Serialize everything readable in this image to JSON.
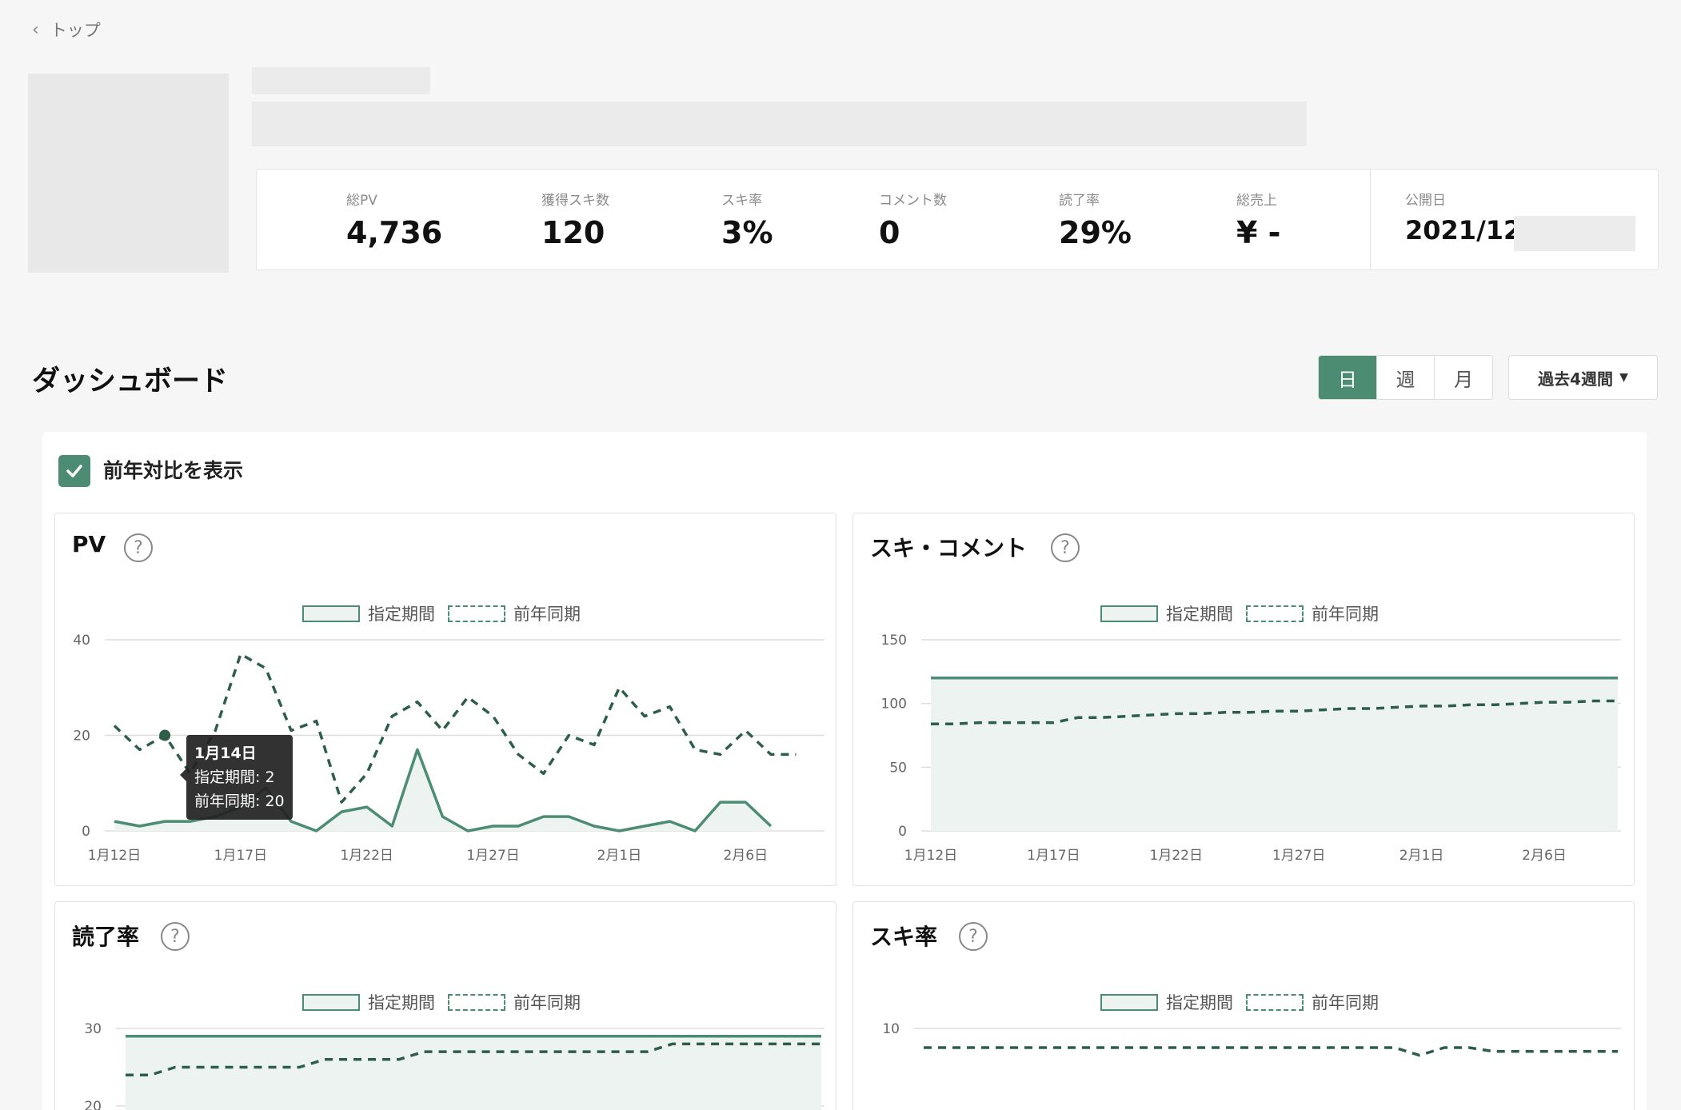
{
  "nav": {
    "back_label": "トップ"
  },
  "stats": [
    {
      "label": "総PV",
      "value": "4,736"
    },
    {
      "label": "獲得スキ数",
      "value": "120"
    },
    {
      "label": "スキ率",
      "value": "3%"
    },
    {
      "label": "コメント数",
      "value": "0"
    },
    {
      "label": "読了率",
      "value": "29%"
    },
    {
      "label": "総売上",
      "value": "¥ -"
    }
  ],
  "published": {
    "label": "公開日",
    "value": "2021/12/"
  },
  "dashboard": {
    "title": "ダッシュボード",
    "period_tabs": [
      "日",
      "週",
      "月"
    ],
    "selected_tab": "日",
    "range_label": "過去4週間",
    "compare_label": "前年対比を表示",
    "compare_checked": true,
    "legend": {
      "current": "指定期間",
      "previous": "前年同期"
    }
  },
  "colors": {
    "accent": "#4b8c72",
    "fill": "#edf3f0",
    "dark_series": "#2e5e4a"
  },
  "tooltip": {
    "title": "1月14日",
    "current_line": "指定期間: 2",
    "previous_line": "前年同期: 20"
  },
  "chart_data": [
    {
      "type": "line",
      "title": "PV",
      "x": [
        "1月12日",
        "1月13日",
        "1月14日",
        "1月15日",
        "1月16日",
        "1月17日",
        "1月18日",
        "1月19日",
        "1月20日",
        "1月21日",
        "1月22日",
        "1月23日",
        "1月24日",
        "1月25日",
        "1月26日",
        "1月27日",
        "1月28日",
        "1月29日",
        "1月30日",
        "1月31日",
        "2月1日",
        "2月2日",
        "2月3日",
        "2月4日",
        "2月5日",
        "2月6日",
        "2月7日",
        "2月8日",
        "2月9日"
      ],
      "x_ticks": [
        "1月12日",
        "1月17日",
        "1月22日",
        "1月27日",
        "2月1日",
        "2月6日"
      ],
      "ylim": [
        0,
        40
      ],
      "y_ticks": [
        0,
        20,
        40
      ],
      "series": [
        {
          "name": "指定期間",
          "style": "solid-area",
          "values": [
            2,
            1,
            2,
            2,
            3,
            5,
            9,
            2,
            0,
            4,
            5,
            1,
            17,
            3,
            0,
            1,
            1,
            3,
            3,
            1,
            0,
            1,
            2,
            0,
            6,
            6,
            1
          ]
        },
        {
          "name": "前年同期",
          "style": "dashed",
          "values": [
            22,
            17,
            20,
            12,
            21,
            37,
            34,
            21,
            23,
            6,
            12,
            24,
            27,
            21,
            28,
            24,
            16,
            12,
            20,
            18,
            30,
            24,
            26,
            17,
            16,
            21,
            16,
            16
          ]
        }
      ]
    },
    {
      "type": "line",
      "title": "スキ・コメント",
      "x_ticks": [
        "1月12日",
        "1月17日",
        "1月22日",
        "1月27日",
        "2月1日",
        "2月6日"
      ],
      "ylim": [
        0,
        150
      ],
      "y_ticks": [
        0,
        50,
        100,
        150
      ],
      "series": [
        {
          "name": "指定期間",
          "style": "solid-area",
          "values": [
            120,
            120,
            120,
            120,
            120,
            120,
            120,
            120,
            120,
            120,
            120,
            120,
            120,
            120,
            120,
            120,
            120,
            120,
            120,
            120,
            120,
            120,
            120,
            120,
            120,
            120,
            120,
            120,
            120
          ]
        },
        {
          "name": "前年同期",
          "style": "dashed",
          "values": [
            84,
            84,
            85,
            85,
            85,
            85,
            89,
            89,
            90,
            91,
            92,
            92,
            93,
            93,
            94,
            94,
            95,
            96,
            96,
            97,
            98,
            98,
            99,
            99,
            100,
            101,
            101,
            102,
            102
          ]
        }
      ]
    },
    {
      "type": "line",
      "title": "読了率",
      "x_ticks": [],
      "ylim": [
        17,
        30
      ],
      "y_ticks": [
        20,
        30
      ],
      "series": [
        {
          "name": "指定期間",
          "style": "solid-area",
          "values": [
            29,
            29,
            29,
            29,
            29,
            29,
            29,
            29,
            29,
            29,
            29,
            29,
            29,
            29,
            29,
            29,
            29,
            29,
            29,
            29,
            29,
            29,
            29,
            29,
            29,
            29,
            29,
            29,
            29
          ]
        },
        {
          "name": "前年同期",
          "style": "dashed",
          "values": [
            24,
            24,
            25,
            25,
            25,
            25,
            25,
            25,
            26,
            26,
            26,
            26,
            27,
            27,
            27,
            27,
            27,
            27,
            27,
            27,
            27,
            27,
            28,
            28,
            28,
            28,
            28,
            28,
            28
          ]
        }
      ]
    },
    {
      "type": "line",
      "title": "スキ率",
      "x_ticks": [],
      "ylim": [
        0,
        10
      ],
      "y_ticks": [
        10
      ],
      "series": [
        {
          "name": "前年同期",
          "style": "dashed",
          "values": [
            9,
            9,
            9,
            9,
            9,
            9,
            9,
            9,
            9,
            9,
            9,
            9,
            9,
            9,
            9,
            9,
            9,
            9,
            9,
            9.0,
            8.6,
            9,
            9,
            8.8,
            8.8,
            8.8,
            8.8,
            8.8,
            8.8
          ]
        }
      ]
    }
  ]
}
